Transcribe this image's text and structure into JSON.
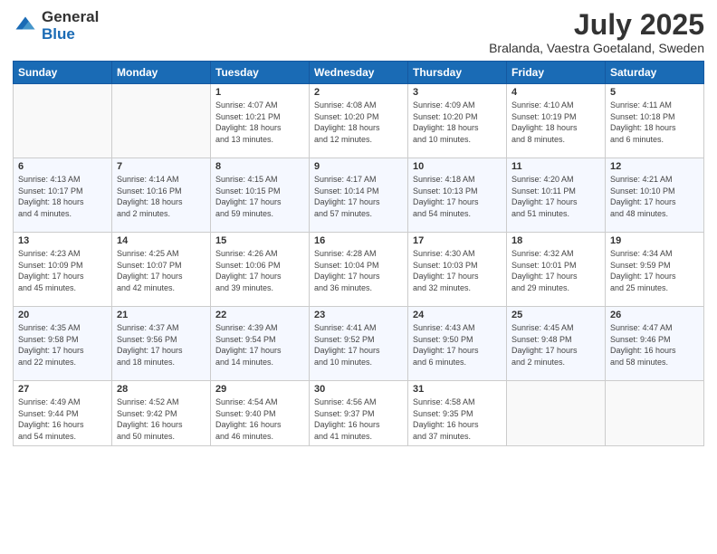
{
  "header": {
    "logo_general": "General",
    "logo_blue": "Blue",
    "month_year": "July 2025",
    "location": "Bralanda, Vaestra Goetaland, Sweden"
  },
  "weekdays": [
    "Sunday",
    "Monday",
    "Tuesday",
    "Wednesday",
    "Thursday",
    "Friday",
    "Saturday"
  ],
  "weeks": [
    [
      {
        "day": "",
        "info": ""
      },
      {
        "day": "",
        "info": ""
      },
      {
        "day": "1",
        "info": "Sunrise: 4:07 AM\nSunset: 10:21 PM\nDaylight: 18 hours\nand 13 minutes."
      },
      {
        "day": "2",
        "info": "Sunrise: 4:08 AM\nSunset: 10:20 PM\nDaylight: 18 hours\nand 12 minutes."
      },
      {
        "day": "3",
        "info": "Sunrise: 4:09 AM\nSunset: 10:20 PM\nDaylight: 18 hours\nand 10 minutes."
      },
      {
        "day": "4",
        "info": "Sunrise: 4:10 AM\nSunset: 10:19 PM\nDaylight: 18 hours\nand 8 minutes."
      },
      {
        "day": "5",
        "info": "Sunrise: 4:11 AM\nSunset: 10:18 PM\nDaylight: 18 hours\nand 6 minutes."
      }
    ],
    [
      {
        "day": "6",
        "info": "Sunrise: 4:13 AM\nSunset: 10:17 PM\nDaylight: 18 hours\nand 4 minutes."
      },
      {
        "day": "7",
        "info": "Sunrise: 4:14 AM\nSunset: 10:16 PM\nDaylight: 18 hours\nand 2 minutes."
      },
      {
        "day": "8",
        "info": "Sunrise: 4:15 AM\nSunset: 10:15 PM\nDaylight: 17 hours\nand 59 minutes."
      },
      {
        "day": "9",
        "info": "Sunrise: 4:17 AM\nSunset: 10:14 PM\nDaylight: 17 hours\nand 57 minutes."
      },
      {
        "day": "10",
        "info": "Sunrise: 4:18 AM\nSunset: 10:13 PM\nDaylight: 17 hours\nand 54 minutes."
      },
      {
        "day": "11",
        "info": "Sunrise: 4:20 AM\nSunset: 10:11 PM\nDaylight: 17 hours\nand 51 minutes."
      },
      {
        "day": "12",
        "info": "Sunrise: 4:21 AM\nSunset: 10:10 PM\nDaylight: 17 hours\nand 48 minutes."
      }
    ],
    [
      {
        "day": "13",
        "info": "Sunrise: 4:23 AM\nSunset: 10:09 PM\nDaylight: 17 hours\nand 45 minutes."
      },
      {
        "day": "14",
        "info": "Sunrise: 4:25 AM\nSunset: 10:07 PM\nDaylight: 17 hours\nand 42 minutes."
      },
      {
        "day": "15",
        "info": "Sunrise: 4:26 AM\nSunset: 10:06 PM\nDaylight: 17 hours\nand 39 minutes."
      },
      {
        "day": "16",
        "info": "Sunrise: 4:28 AM\nSunset: 10:04 PM\nDaylight: 17 hours\nand 36 minutes."
      },
      {
        "day": "17",
        "info": "Sunrise: 4:30 AM\nSunset: 10:03 PM\nDaylight: 17 hours\nand 32 minutes."
      },
      {
        "day": "18",
        "info": "Sunrise: 4:32 AM\nSunset: 10:01 PM\nDaylight: 17 hours\nand 29 minutes."
      },
      {
        "day": "19",
        "info": "Sunrise: 4:34 AM\nSunset: 9:59 PM\nDaylight: 17 hours\nand 25 minutes."
      }
    ],
    [
      {
        "day": "20",
        "info": "Sunrise: 4:35 AM\nSunset: 9:58 PM\nDaylight: 17 hours\nand 22 minutes."
      },
      {
        "day": "21",
        "info": "Sunrise: 4:37 AM\nSunset: 9:56 PM\nDaylight: 17 hours\nand 18 minutes."
      },
      {
        "day": "22",
        "info": "Sunrise: 4:39 AM\nSunset: 9:54 PM\nDaylight: 17 hours\nand 14 minutes."
      },
      {
        "day": "23",
        "info": "Sunrise: 4:41 AM\nSunset: 9:52 PM\nDaylight: 17 hours\nand 10 minutes."
      },
      {
        "day": "24",
        "info": "Sunrise: 4:43 AM\nSunset: 9:50 PM\nDaylight: 17 hours\nand 6 minutes."
      },
      {
        "day": "25",
        "info": "Sunrise: 4:45 AM\nSunset: 9:48 PM\nDaylight: 17 hours\nand 2 minutes."
      },
      {
        "day": "26",
        "info": "Sunrise: 4:47 AM\nSunset: 9:46 PM\nDaylight: 16 hours\nand 58 minutes."
      }
    ],
    [
      {
        "day": "27",
        "info": "Sunrise: 4:49 AM\nSunset: 9:44 PM\nDaylight: 16 hours\nand 54 minutes."
      },
      {
        "day": "28",
        "info": "Sunrise: 4:52 AM\nSunset: 9:42 PM\nDaylight: 16 hours\nand 50 minutes."
      },
      {
        "day": "29",
        "info": "Sunrise: 4:54 AM\nSunset: 9:40 PM\nDaylight: 16 hours\nand 46 minutes."
      },
      {
        "day": "30",
        "info": "Sunrise: 4:56 AM\nSunset: 9:37 PM\nDaylight: 16 hours\nand 41 minutes."
      },
      {
        "day": "31",
        "info": "Sunrise: 4:58 AM\nSunset: 9:35 PM\nDaylight: 16 hours\nand 37 minutes."
      },
      {
        "day": "",
        "info": ""
      },
      {
        "day": "",
        "info": ""
      }
    ]
  ]
}
